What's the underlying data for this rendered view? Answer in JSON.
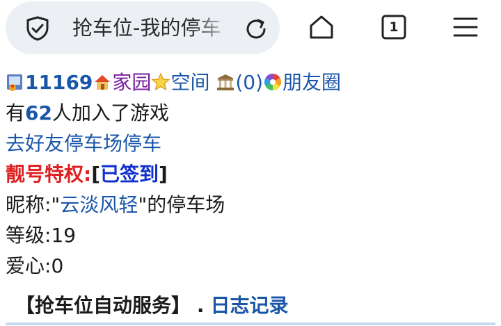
{
  "browser": {
    "url_text": "抢车位-我的停车",
    "tab_count": "1"
  },
  "header": {
    "user_id": "11169",
    "home_label": "家园",
    "space_label": "空间",
    "count_label": "(0)",
    "friends_label": "朋友圈"
  },
  "stats": {
    "joined_prefix": "有",
    "joined_count": "62",
    "joined_suffix": "人加入了游戏"
  },
  "links": {
    "friend_parking": "去好友停车场停车"
  },
  "privilege": {
    "label": "靓号特权:",
    "bracket_open": "[",
    "status": "已签到",
    "bracket_close": "]"
  },
  "profile": {
    "nickname_prefix": "昵称:\"",
    "nickname": "云淡风轻",
    "nickname_suffix": "\"的停车场",
    "level_label": "等级:",
    "level_value": "19",
    "love_label": "爱心:",
    "love_value": "0"
  },
  "footer": {
    "auto_service": "【抢车位自动服务】",
    "separator": ".",
    "log_link": "日志记录"
  },
  "colors": {
    "link": "#1a56a8",
    "red": "#e02020",
    "urlbar_bg": "#eceff3"
  }
}
